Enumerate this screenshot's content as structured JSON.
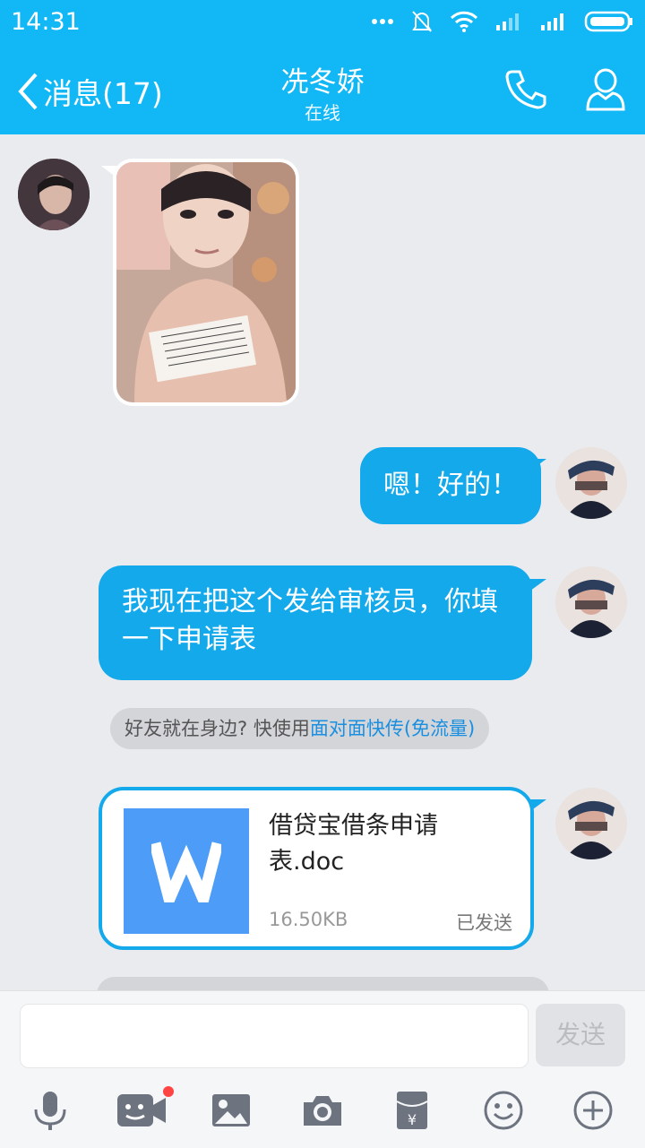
{
  "status_bar": {
    "time": "14:31"
  },
  "header": {
    "back_label": "消息(17)",
    "contact_name": "冼冬娇",
    "contact_status": "在线"
  },
  "messages": {
    "sent_1": "嗯！好的！",
    "sent_2": "我现在把这个发给审核员，你填一下申请表",
    "tip_prefix": "好友就在身边? 快使用",
    "tip_link": "面对面快传(免流量)",
    "file_name": "借贷宝借条申请表.doc",
    "file_size": "16.50KB",
    "file_status": "已发送"
  },
  "input": {
    "value": "",
    "send_label": "发送"
  },
  "toolbar": [
    "mic-icon",
    "video-icon",
    "image-icon",
    "camera-icon",
    "red-packet-icon",
    "emoji-icon",
    "plus-icon"
  ],
  "colors": {
    "header": "#12b7f5",
    "bubble": "#14a9ea",
    "background": "#eaebef"
  }
}
